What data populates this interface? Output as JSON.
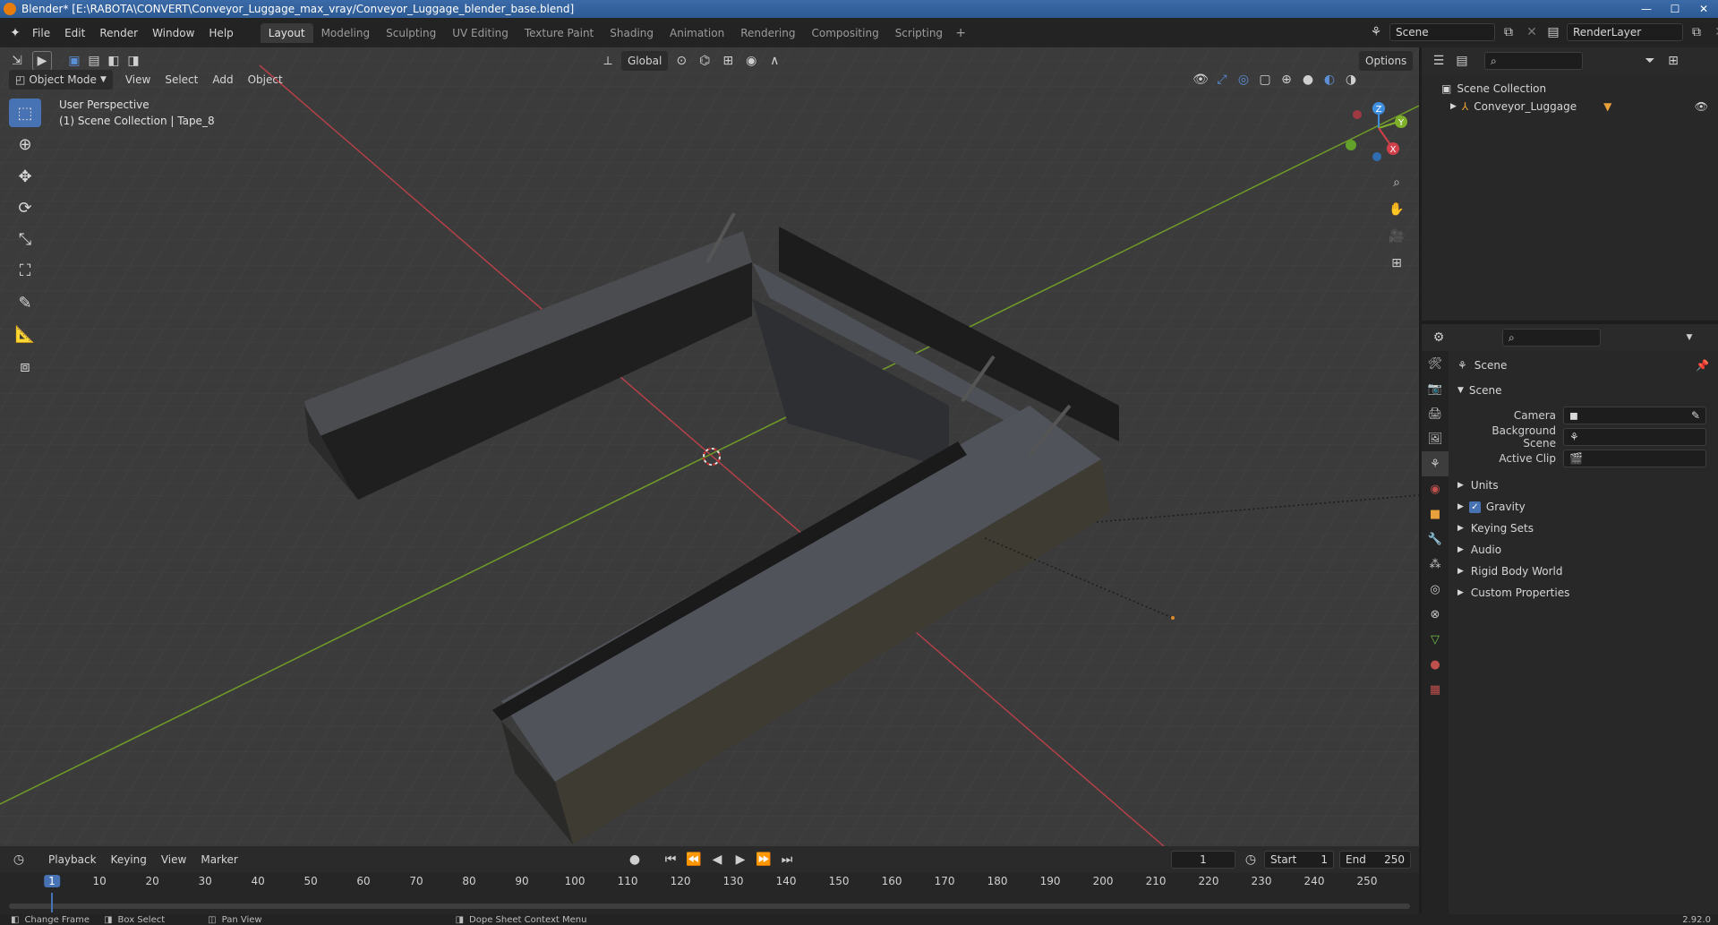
{
  "window": {
    "title": "Blender* [E:\\RABOTA\\CONVERT\\Conveyor_Luggage_max_vray/Conveyor_Luggage_blender_base.blend]"
  },
  "menu": [
    "File",
    "Edit",
    "Render",
    "Window",
    "Help"
  ],
  "workspaces": [
    {
      "label": "Layout",
      "active": true
    },
    {
      "label": "Modeling"
    },
    {
      "label": "Sculpting"
    },
    {
      "label": "UV Editing"
    },
    {
      "label": "Texture Paint"
    },
    {
      "label": "Shading"
    },
    {
      "label": "Animation"
    },
    {
      "label": "Rendering"
    },
    {
      "label": "Compositing"
    },
    {
      "label": "Scripting"
    }
  ],
  "topright": {
    "scene": "Scene",
    "render_layer": "RenderLayer"
  },
  "viewport": {
    "mode": "Object Mode",
    "menus": [
      "View",
      "Select",
      "Add",
      "Object"
    ],
    "transform_orientation": "Global",
    "options_label": "Options",
    "info_line1": "User Perspective",
    "info_line2": "(1) Scene Collection | Tape_8",
    "gizmo": {
      "z": "Z",
      "y": "Y",
      "x": "X"
    }
  },
  "outliner": {
    "root": "Scene Collection",
    "items": [
      {
        "label": "Conveyor_Luggage"
      }
    ]
  },
  "properties": {
    "header": "Scene",
    "section": "Scene",
    "fields": [
      {
        "label": "Camera",
        "value": ""
      },
      {
        "label": "Background Scene",
        "value": ""
      },
      {
        "label": "Active Clip",
        "value": ""
      }
    ],
    "panels": [
      {
        "label": "Units",
        "checkbox": false
      },
      {
        "label": "Gravity",
        "checkbox": true
      },
      {
        "label": "Keying Sets",
        "checkbox": false
      },
      {
        "label": "Audio",
        "checkbox": false
      },
      {
        "label": "Rigid Body World",
        "checkbox": false
      },
      {
        "label": "Custom Properties",
        "checkbox": false
      }
    ]
  },
  "timeline": {
    "menus": [
      "Playback",
      "Keying",
      "View",
      "Marker"
    ],
    "current_frame": "1",
    "start_label": "Start",
    "start": "1",
    "end_label": "End",
    "end": "250",
    "ticks": [
      "1",
      "10",
      "20",
      "30",
      "40",
      "50",
      "60",
      "70",
      "80",
      "90",
      "100",
      "110",
      "120",
      "130",
      "140",
      "150",
      "160",
      "170",
      "180",
      "190",
      "200",
      "210",
      "220",
      "230",
      "240",
      "250"
    ]
  },
  "status": {
    "items": [
      "Change Frame",
      "Box Select",
      "Pan View",
      "Dope Sheet Context Menu"
    ],
    "version": "2.92.0"
  },
  "colors": {
    "accent": "#4772b3",
    "x_axis": "#d0404a",
    "y_axis": "#7fb02a",
    "z_axis": "#3f8fe0"
  }
}
